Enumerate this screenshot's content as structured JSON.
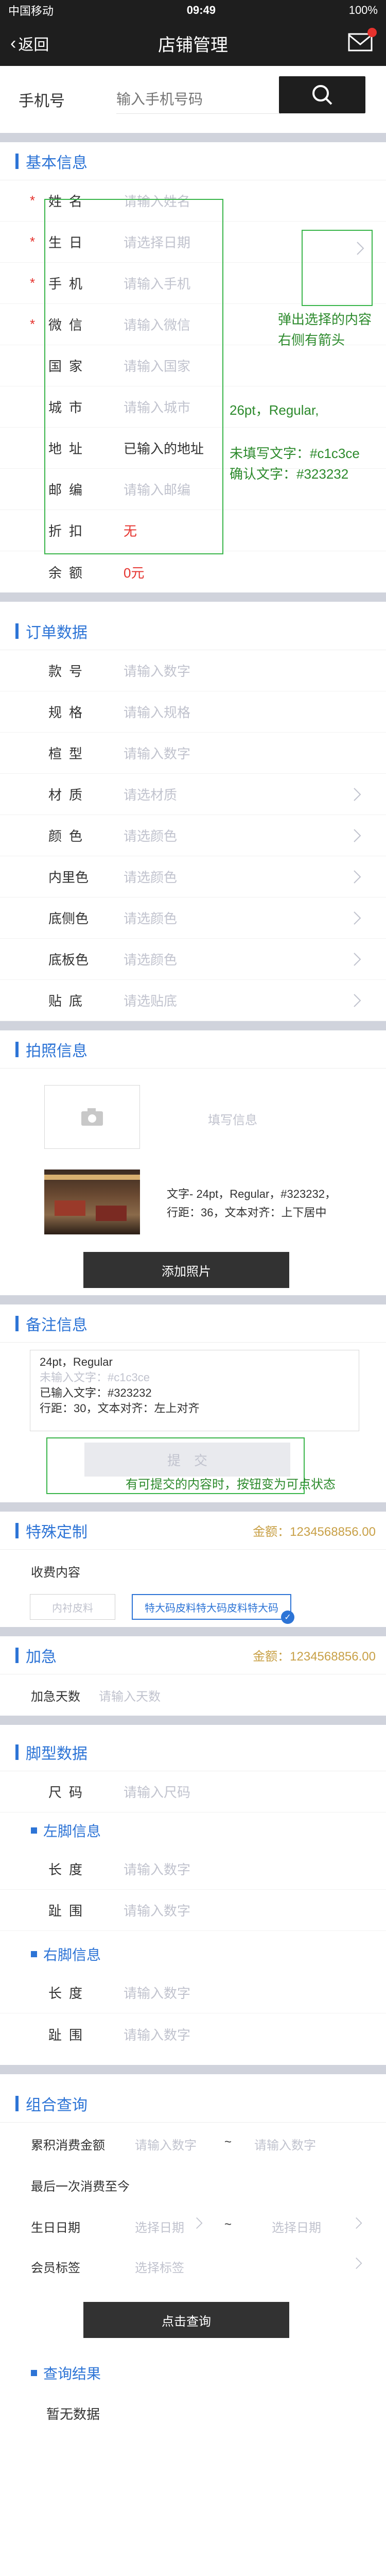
{
  "status": {
    "carrier": "中国移动",
    "time": "09:49",
    "battery": "100%"
  },
  "nav": {
    "back": "返回",
    "title": "店铺管理"
  },
  "search": {
    "label": "手机号",
    "placeholder": "输入手机号码"
  },
  "basic": {
    "title": "基本信息",
    "rows": [
      {
        "label": "姓名",
        "value": "请输入姓名",
        "required": "*"
      },
      {
        "label": "生日",
        "value": "请选择日期",
        "required": "*"
      },
      {
        "label": "手机",
        "value": "请输入手机",
        "required": "*"
      },
      {
        "label": "微信",
        "value": "请输入微信",
        "required": "*"
      },
      {
        "label": "国家",
        "value": "请输入国家"
      },
      {
        "label": "城市",
        "value": "请输入城市"
      },
      {
        "label": "地址",
        "value": "已输入的地址"
      },
      {
        "label": "邮编",
        "value": "请输入邮编"
      },
      {
        "label": "折扣",
        "value": "无"
      },
      {
        "label": "余额",
        "value": "0元"
      }
    ],
    "notes": {
      "popup": "弹出选择的内容\n右侧有箭头",
      "font": "26pt，Regular,",
      "colors": "未填写文字：#c1c3ce\n确认文字：#323232"
    }
  },
  "order": {
    "title": "订单数据",
    "rows": [
      {
        "label": "款号",
        "value": "请输入数字"
      },
      {
        "label": "规格",
        "value": "请输入规格"
      },
      {
        "label": "楦型",
        "value": "请输入数字"
      },
      {
        "label": "材质",
        "value": "请选材质"
      },
      {
        "label": "颜色",
        "value": "请选颜色"
      },
      {
        "label": "内里色",
        "value": "请选颜色"
      },
      {
        "label": "底侧色",
        "value": "请选颜色"
      },
      {
        "label": "底板色",
        "value": "请选颜色"
      },
      {
        "label": "贴底",
        "value": "请选贴底"
      }
    ]
  },
  "photo": {
    "title": "拍照信息",
    "fill_hint": "填写信息",
    "caption": "文字- 24pt，Regular，#323232，\n行距：36，文本对齐：上下居中",
    "add_button": "添加照片"
  },
  "remark": {
    "title": "备注信息",
    "text_lines": [
      "24pt，Regular",
      "未输入文字：#c1c3ce",
      "已输入文字：#323232",
      "行距：30，文本对齐：左上对齐"
    ],
    "submit": "提　交",
    "submit_note": "有可提交的内容时，按钮变为可点状态"
  },
  "custom": {
    "title": "特殊定制",
    "amount": "金额：1234568856.00",
    "content_label": "收费内容",
    "tag1": "内衬皮料",
    "tag2": "特大码皮料特大码皮料特大码"
  },
  "urgent": {
    "title": "加急",
    "amount": "金额：1234568856.00",
    "days_label": "加急天数",
    "days_placeholder": "请输入天数"
  },
  "foot": {
    "title": "脚型数据",
    "size": {
      "label": "尺码",
      "value": "请输入尺码"
    },
    "left": {
      "title": "左脚信息",
      "rows": [
        {
          "label": "长度",
          "value": "请输入数字"
        },
        {
          "label": "趾围",
          "value": "请输入数字"
        }
      ]
    },
    "right": {
      "title": "右脚信息",
      "rows": [
        {
          "label": "长度",
          "value": "请输入数字"
        },
        {
          "label": "趾围",
          "value": "请输入数字"
        }
      ]
    }
  },
  "query": {
    "title": "组合查询",
    "amount_label": "累积消费金额",
    "amount_from": "请输入数字",
    "tilde": "~",
    "amount_to": "请输入数字",
    "last_label": "最后一次消费至今",
    "birthday_label": "生日日期",
    "birthday_from": "选择日期",
    "birthday_to": "选择日期",
    "tag_label": "会员标签",
    "tag_value": "选择标签",
    "button": "点击查询",
    "result_title": "查询结果",
    "empty": "暂无数据"
  },
  "colors": {
    "accent": "#2d74d6",
    "placeholder": "#c1c3ce",
    "text": "#323232",
    "required": "#e5322d",
    "annotation": "#39b54a",
    "amount": "#c8a046"
  }
}
